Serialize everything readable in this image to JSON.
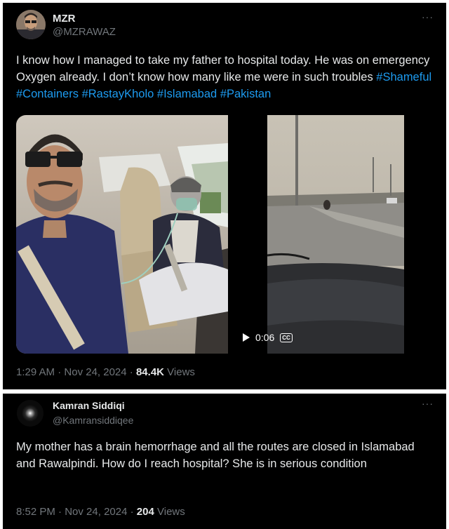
{
  "tweet1": {
    "display_name": "MZR",
    "handle": "@MZRAWAZ",
    "more": "···",
    "text_plain": "I know how I managed to take my father to hospital today. He was on emergency Oxygen already. I don’t know how many like me were in such troubles ",
    "hashtags": [
      "#Shameful",
      "#Containers",
      "#RastayKholo",
      "#Islamabad",
      "#Pakistan"
    ],
    "video_time": "0:06",
    "cc_label": "CC",
    "time": "1:29 AM",
    "date": "Nov 24, 2024",
    "views_count": "84.4K",
    "views_label": "Views"
  },
  "tweet2": {
    "display_name": "Kamran Siddiqi",
    "handle": "@Kamransiddiqee",
    "more": "···",
    "text": "My mother has a brain hemorrhage and all the routes are closed in Islamabad and Rawalpindi. How do I reach hospital? She is in serious condition",
    "time": "8:52 PM",
    "date": "Nov 24, 2024",
    "views_count": "204",
    "views_label": "Views"
  },
  "separator": "·",
  "colors": {
    "background": "#000000",
    "text": "#e7e9ea",
    "muted": "#71767b",
    "link": "#1d9bf0"
  }
}
